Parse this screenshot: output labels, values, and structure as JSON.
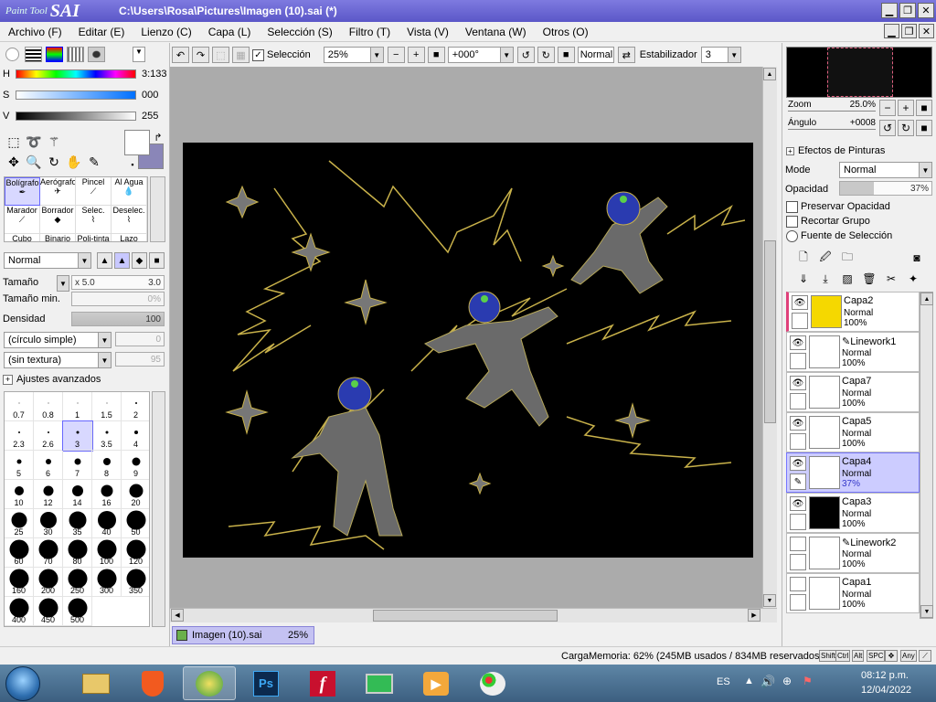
{
  "window": {
    "app_name_small": "Paint Tool",
    "app_name_big": "SAI",
    "title": "C:\\Users\\Rosa\\Pictures\\Imagen (10).sai (*)"
  },
  "menu": [
    "Archivo (F)",
    "Editar (E)",
    "Lienzo (C)",
    "Capa (L)",
    "Selección (S)",
    "Filtro (T)",
    "Vista (V)",
    "Ventana (W)",
    "Otros (O)"
  ],
  "color": {
    "h_label": "H",
    "s_label": "S",
    "v_label": "V",
    "h_value": "3:133",
    "s_value": "000",
    "v_value": "255",
    "fg": "#ffffff",
    "bg": "#8a86b8"
  },
  "brushes": [
    {
      "label": "Bolígrafo",
      "selected": true
    },
    {
      "label": "Aerógrafo"
    },
    {
      "label": "Pincel"
    },
    {
      "label": "Al Agua"
    },
    {
      "label": "Marador"
    },
    {
      "label": "Borrador"
    },
    {
      "label": "Selec."
    },
    {
      "label": "Deselec."
    },
    {
      "label": "Cubo"
    },
    {
      "label": "Binario"
    },
    {
      "label": "Poli-tinta"
    },
    {
      "label": "Lazo"
    }
  ],
  "brush_settings": {
    "blend_mode": "Normal",
    "size_label": "Tamaño",
    "size_multiplier": "x 5.0",
    "size_value": "3.0",
    "min_size_label": "Tamaño min.",
    "min_size_value": "0%",
    "density_label": "Densidad",
    "density_value": "100",
    "shape": "(círculo simple)",
    "shape_value": "0",
    "texture": "(sin textura)",
    "texture_value": "95",
    "advanced": "Ajustes avanzados"
  },
  "brush_sizes": [
    {
      "label": "0.7",
      "dot": 1
    },
    {
      "label": "0.8",
      "dot": 1
    },
    {
      "label": "1",
      "dot": 1
    },
    {
      "label": "1.5",
      "dot": 1
    },
    {
      "label": "2",
      "dot": 2
    },
    {
      "label": "2.3",
      "dot": 2
    },
    {
      "label": "2.6",
      "dot": 2
    },
    {
      "label": "3",
      "dot": 3,
      "selected": true
    },
    {
      "label": "3.5",
      "dot": 3
    },
    {
      "label": "4",
      "dot": 4
    },
    {
      "label": "5",
      "dot": 5
    },
    {
      "label": "6",
      "dot": 6
    },
    {
      "label": "7",
      "dot": 7
    },
    {
      "label": "8",
      "dot": 8
    },
    {
      "label": "9",
      "dot": 9
    },
    {
      "label": "10",
      "dot": 10
    },
    {
      "label": "12",
      "dot": 11
    },
    {
      "label": "14",
      "dot": 12
    },
    {
      "label": "16",
      "dot": 13
    },
    {
      "label": "20",
      "dot": 15
    },
    {
      "label": "25",
      "dot": 17
    },
    {
      "label": "30",
      "dot": 18
    },
    {
      "label": "35",
      "dot": 19
    },
    {
      "label": "40",
      "dot": 20
    },
    {
      "label": "50",
      "dot": 21
    },
    {
      "label": "60",
      "dot": 21
    },
    {
      "label": "70",
      "dot": 21
    },
    {
      "label": "80",
      "dot": 21
    },
    {
      "label": "100",
      "dot": 21
    },
    {
      "label": "120",
      "dot": 21
    },
    {
      "label": "160",
      "dot": 21
    },
    {
      "label": "200",
      "dot": 21
    },
    {
      "label": "250",
      "dot": 21
    },
    {
      "label": "300",
      "dot": 21
    },
    {
      "label": "350",
      "dot": 21
    },
    {
      "label": "400",
      "dot": 21
    },
    {
      "label": "450",
      "dot": 21
    },
    {
      "label": "500",
      "dot": 21
    }
  ],
  "toolbar": {
    "selection_label": "Selección",
    "zoom": "25%",
    "rotation": "+000°",
    "blend": "Normal",
    "stabilizer_label": "Estabilizador",
    "stabilizer_value": "3"
  },
  "navigator": {
    "zoom_label": "Zoom",
    "zoom_value": "25.0%",
    "angle_label": "Ángulo",
    "angle_value": "+0008"
  },
  "layer_panel": {
    "effects_label": "Efectos de Pinturas",
    "mode_label": "Mode",
    "mode_value": "Normal",
    "opacity_label": "Opacidad",
    "opacity_value": "37%",
    "opacity_fraction": 0.37,
    "preserve_opacity": "Preservar Opacidad",
    "clip_group": "Recortar Grupo",
    "selection_source": "Fuente de Selección"
  },
  "layers": [
    {
      "name": "Capa2",
      "mode": "Normal",
      "opacity": "100%",
      "visible": true,
      "thumb": "#f5d800",
      "marked": true
    },
    {
      "name": "Linework1",
      "mode": "Normal",
      "opacity": "100%",
      "visible": true,
      "thumb": "#ffffff",
      "pen": true
    },
    {
      "name": "Capa7",
      "mode": "Normal",
      "opacity": "100%",
      "visible": true,
      "thumb": "#ffffff"
    },
    {
      "name": "Capa5",
      "mode": "Normal",
      "opacity": "100%",
      "visible": true,
      "thumb": "#ffffff"
    },
    {
      "name": "Capa4",
      "mode": "Normal",
      "opacity": "37%",
      "visible": true,
      "thumb": "#ffffff",
      "selected": true
    },
    {
      "name": "Capa3",
      "mode": "Normal",
      "opacity": "100%",
      "visible": true,
      "thumb": "#000000"
    },
    {
      "name": "Linework2",
      "mode": "Normal",
      "opacity": "100%",
      "visible": false,
      "thumb": "#ffffff",
      "pen": true
    },
    {
      "name": "Capa1",
      "mode": "Normal",
      "opacity": "100%",
      "visible": false,
      "thumb": "#ffffff"
    }
  ],
  "document_tab": {
    "name": "Imagen (10).sai",
    "zoom": "25%"
  },
  "status": {
    "memory": "CargaMemoria: 62% (245MB usados / 834MB reservados)",
    "keys": [
      "Shift",
      "Ctrl",
      "Alt",
      "SPC",
      "Any"
    ]
  },
  "taskbar": {
    "apps": [
      "Explorador",
      "Brave",
      "PaintTool SAI",
      "Photoshop",
      "Flash",
      "Monitor",
      "Video",
      "Paint"
    ],
    "lang": "ES",
    "time": "08:12 p.m.",
    "date": "12/04/2022"
  }
}
